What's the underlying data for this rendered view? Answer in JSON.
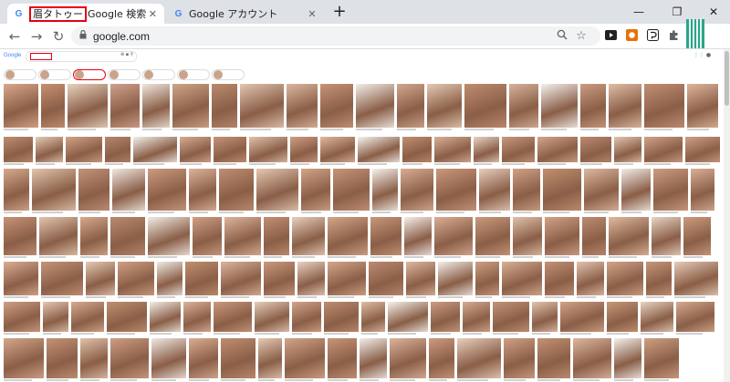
{
  "tabs": [
    {
      "title_highlight": "眉タトゥー",
      "title_rest": "Google 検索",
      "icon": "google-g-icon",
      "active": true
    },
    {
      "title": "Google アカウント",
      "icon": "google-g-icon",
      "active": false
    }
  ],
  "window": {
    "new_tab": "+",
    "minimize": "—",
    "restore": "❐",
    "close": "✕"
  },
  "toolbar": {
    "back": "←",
    "forward": "→",
    "reload": "↻",
    "url": "google.com",
    "lock": "🔒"
  },
  "colors": {
    "accent_red": "#e60012",
    "tab_bg": "#dee1e6",
    "extension_green": "#2aa58a"
  },
  "results": {
    "rows": [
      [
        "#d9a88a",
        "#c89070",
        "#e8d2c0",
        "#d1a08b",
        "#f0e6dc",
        "#cfa587",
        "#b98a6d",
        "#e2c5b0",
        "#dbb79f",
        "#c79377",
        "#f2eee8",
        "#d0a78f",
        "#e5c9b3",
        "#bf8d70",
        "#d8b29a",
        "#f4f0ec",
        "#cc9c80",
        "#e0bda5",
        "#c28f74",
        "#deb59b",
        "#d7a98c",
        "#e9d7c8",
        "#c99579",
        "#dcb39a"
      ],
      [
        "#c08d72",
        "#e6cbb6",
        "#d3a386",
        "#b7876c",
        "#f3efe9",
        "#d6ad93",
        "#c69477",
        "#e1c2ac",
        "#cd9e82",
        "#dfb99f",
        "#f6f3ef",
        "#c48f71",
        "#d9b097",
        "#e8d3c2",
        "#c99a7f",
        "#d4a68a",
        "#bb8b70",
        "#e3c6b0",
        "#d1a28a",
        "#cfa085",
        "#f1ece6",
        "#c7977b"
      ],
      [
        "#d6aa8e",
        "#e2c4ae",
        "#c39378",
        "#f0e7df",
        "#cc9b7f",
        "#dbb49b",
        "#bf8e72",
        "#e4c8b3",
        "#d2a488",
        "#c69579",
        "#f5f1ec",
        "#d8ad94",
        "#ca987c",
        "#e6cebc",
        "#d0a186",
        "#c1906f",
        "#ddb8a0",
        "#f2ede7",
        "#cd9d82",
        "#d9af96",
        "#e0c0aa"
      ],
      [
        "#c59377",
        "#e3c5af",
        "#d5a98d",
        "#b98a6e",
        "#f2ece5",
        "#cf9f84",
        "#dcb59c",
        "#c28f73",
        "#e7d0be",
        "#d3a68a",
        "#c89779",
        "#f4f0eb",
        "#daaf95",
        "#ca9a7e",
        "#e1c1ab",
        "#d1a387",
        "#bd8c71",
        "#dfba9f",
        "#e9d5c4",
        "#cc9c80",
        "#d7ac92",
        "#c49276"
      ],
      [
        "#daae93",
        "#c69579",
        "#e5cab5",
        "#d0a084",
        "#f1ebe4",
        "#c0906f",
        "#dcb49b",
        "#cb9a7e",
        "#e8d2c1",
        "#d4a78b",
        "#bc8b70",
        "#deb79e",
        "#f3eee8",
        "#ce9e82",
        "#d9af95",
        "#c39175",
        "#e2c3ad",
        "#d2a589",
        "#c89678",
        "#e6ccb9",
        "#d5a98e"
      ],
      [
        "#cf9f83",
        "#e4c7b2",
        "#d8ab90",
        "#c1906f",
        "#f2ede6",
        "#dbb39a",
        "#ca997d",
        "#e6cebb",
        "#d3a589",
        "#be8d71",
        "#e0bca3",
        "#f5f1ec",
        "#cd9c81",
        "#d7ab91",
        "#c59477",
        "#e3c4ae",
        "#d1a286",
        "#c89779",
        "#e8d3c2",
        "#d6aa8f",
        "#c09072",
        "#dfb89f"
      ],
      [
        "#d4a68b",
        "#c49376",
        "#e1c1ab",
        "#cd9d82",
        "#f0e9e2",
        "#d9ae94",
        "#bf8e71",
        "#e5c9b5",
        "#d2a488",
        "#c79578",
        "#f3eee9",
        "#dbb39a",
        "#cb9b7f",
        "#e7cfbd",
        "#d0a085",
        "#c29174",
        "#deb79e",
        "#f4f0ea",
        "#ce9f83",
        "#d8ad93"
      ]
    ]
  }
}
